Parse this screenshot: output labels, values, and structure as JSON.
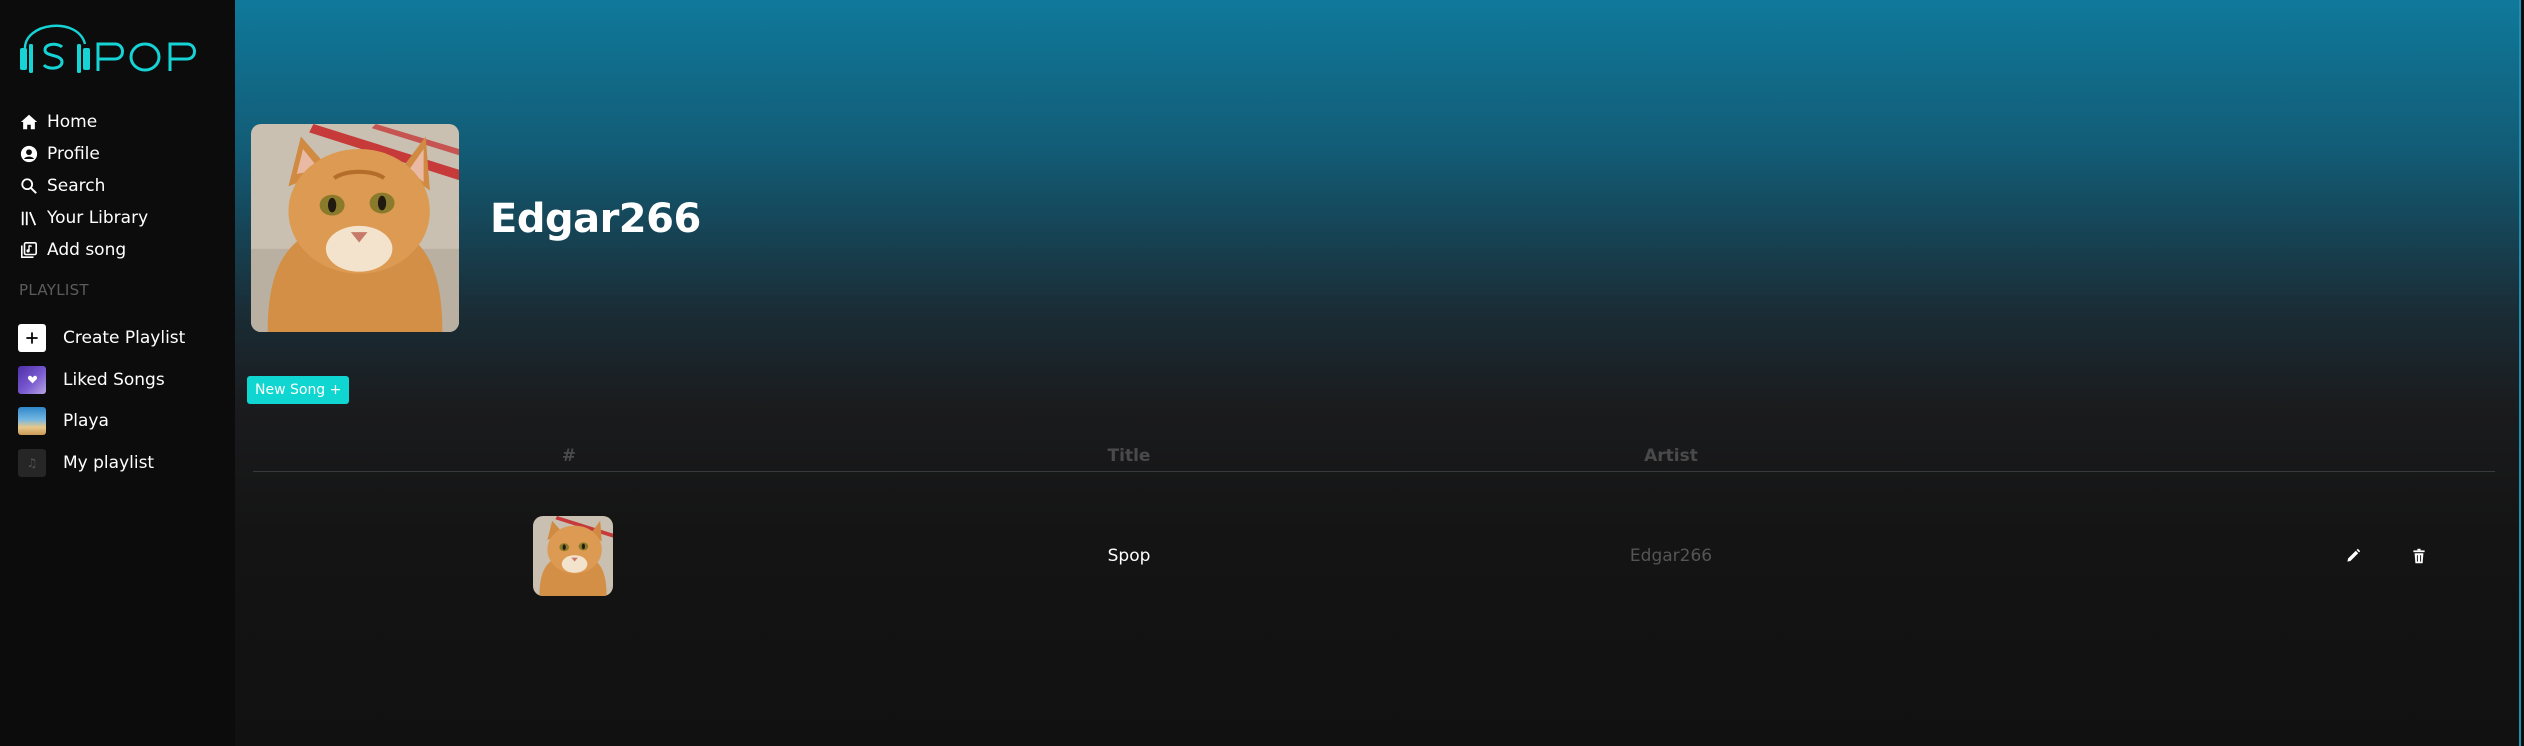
{
  "brand": {
    "logo_text": "SPOP",
    "accent_color": "#16d3d6"
  },
  "sidebar": {
    "nav": [
      {
        "label": "Home",
        "icon": "home-icon"
      },
      {
        "label": "Profile",
        "icon": "user-circle-icon"
      },
      {
        "label": "Search",
        "icon": "search-icon"
      },
      {
        "label": "Your Library",
        "icon": "library-icon"
      },
      {
        "label": "Add song",
        "icon": "add-song-icon"
      }
    ],
    "section_heading": "PLAYLIST",
    "playlists": [
      {
        "label": "Create Playlist",
        "icon": "plus-icon"
      },
      {
        "label": "Liked Songs",
        "icon": "heart-icon"
      },
      {
        "label": "Playa",
        "icon": "playlist-cover-image"
      },
      {
        "label": "My playlist",
        "icon": "music-note-icon"
      }
    ]
  },
  "profile": {
    "username": "Edgar266",
    "avatar": "cat-photo"
  },
  "actions": {
    "new_song_label": "New Song +"
  },
  "table": {
    "headers": {
      "number": "#",
      "title": "Title",
      "artist": "Artist"
    },
    "rows": [
      {
        "cover": "cat-photo",
        "title": "Spop",
        "artist": "Edgar266"
      }
    ]
  },
  "colors": {
    "header_gradient_top": "#10799b",
    "background": "#121212",
    "sidebar": "#0c0c0c",
    "button": "#0fd6d0"
  }
}
